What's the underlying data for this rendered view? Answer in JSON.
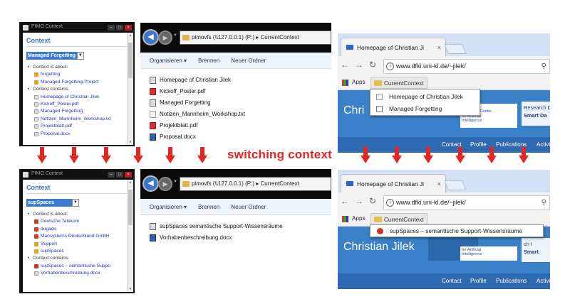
{
  "top": {
    "context_window": {
      "title": "PIMO Context",
      "heading": "Context",
      "selected": "Managed Forgetting",
      "about_label": "Context is about:",
      "about": [
        "forgetting",
        "Managed Forgetting-Project"
      ],
      "contains_label": "Context contains:",
      "contains": [
        "Homepage of Christian Jilek",
        "Kickoff_Poster.pdf",
        "Managed Forgetting",
        "Notizen_Mannheim_Workshop.txt",
        "Projektblatt.pdf",
        "Proposal.docx"
      ]
    },
    "explorer": {
      "path": "pimovfs (\\\\127.0.0.1) (P:)  ▸  CurrentContext",
      "toolbar": [
        "Organisieren ▾",
        "Brennen",
        "Neuer Ordner"
      ],
      "files": [
        "Homepage of Christian Jilek",
        "Kickoff_Poster.pdf",
        "Managed Forgetting",
        "Notizen_Mannheim_Workshop.txt",
        "Projektblatt.pdf",
        "Proposal.docx"
      ]
    },
    "browser": {
      "tab": "Homepage of Christian Ji",
      "url": "www.dfki.uni-kl.de/~jilek/",
      "apps": "Apps",
      "bookmark": "CurrentContext",
      "menu": [
        "Homepage of Christian Jilek",
        "Managed Forgetting"
      ],
      "page_title": "Chri",
      "logo_text": [
        "German",
        "Research Center",
        "for Artificial",
        "Intelligence"
      ],
      "right_text": [
        "Research D",
        "Smart Da"
      ],
      "nav": [
        "Contact",
        "Profile",
        "Publications",
        "Activi"
      ]
    }
  },
  "bottom": {
    "context_window": {
      "title": "PIMO Context",
      "heading": "Context",
      "selected": "supSpaces",
      "about_label": "Context is about:",
      "about": [
        "Deutsche Telekom",
        "dogado",
        "Mansystems Deutschland GmbH",
        "Support",
        "supSpaces"
      ],
      "contains_label": "Context contains:",
      "contains": [
        "supSpaces – semantische Suppo",
        "Vorhabenbeschreibung.docx"
      ]
    },
    "explorer": {
      "path": "pimovfs (\\\\127.0.0.1) (P:)  ▸  CurrentContext",
      "toolbar": [
        "Organisieren ▾",
        "Brennen",
        "Neuer Ordner"
      ],
      "files": [
        "supSpaces  semantische Support-Wissensräume",
        "Vorhabenbeschreibung.docx"
      ]
    },
    "browser": {
      "tab": "Homepage of Christian Ji",
      "url": "www.dfki.uni-kl.de/~jilek/",
      "apps": "Apps",
      "bookmark": "CurrentContext",
      "menu": [
        "supSpaces – semantische Support-Wissensräume"
      ],
      "page_title": "Christian Jilek",
      "logo_text": [
        "for Artificial",
        "Intelligence"
      ],
      "right_text": [
        "ch I",
        "Smart"
      ],
      "nav": [
        "Contact",
        "Profile",
        "Publications",
        "Activi"
      ]
    }
  },
  "caption": "switching context",
  "colors": {
    "arrow": "#e52520",
    "link": "#2233bb",
    "accent": "#3c7ad6",
    "page": "#3a80c8"
  }
}
